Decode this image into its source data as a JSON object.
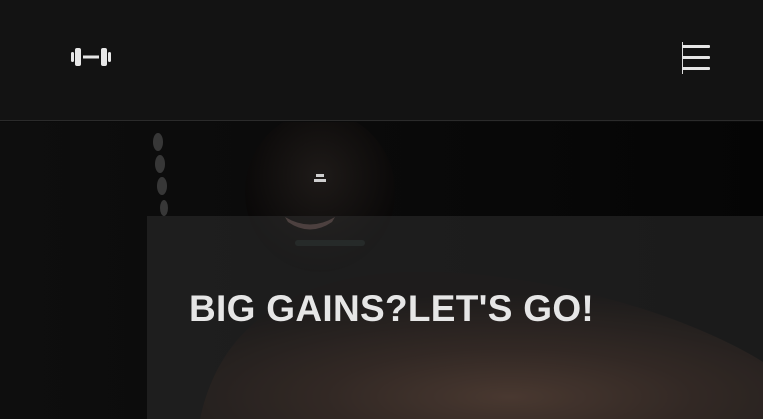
{
  "header": {
    "logo_icon": "dumbbell-icon",
    "menu_icon": "hamburger-menu-icon",
    "background": "#131313"
  },
  "hero": {
    "title": "BIG GAINS?LET'S GO!",
    "image": "athlete-photo",
    "panel_color": "#2d2d2d"
  }
}
